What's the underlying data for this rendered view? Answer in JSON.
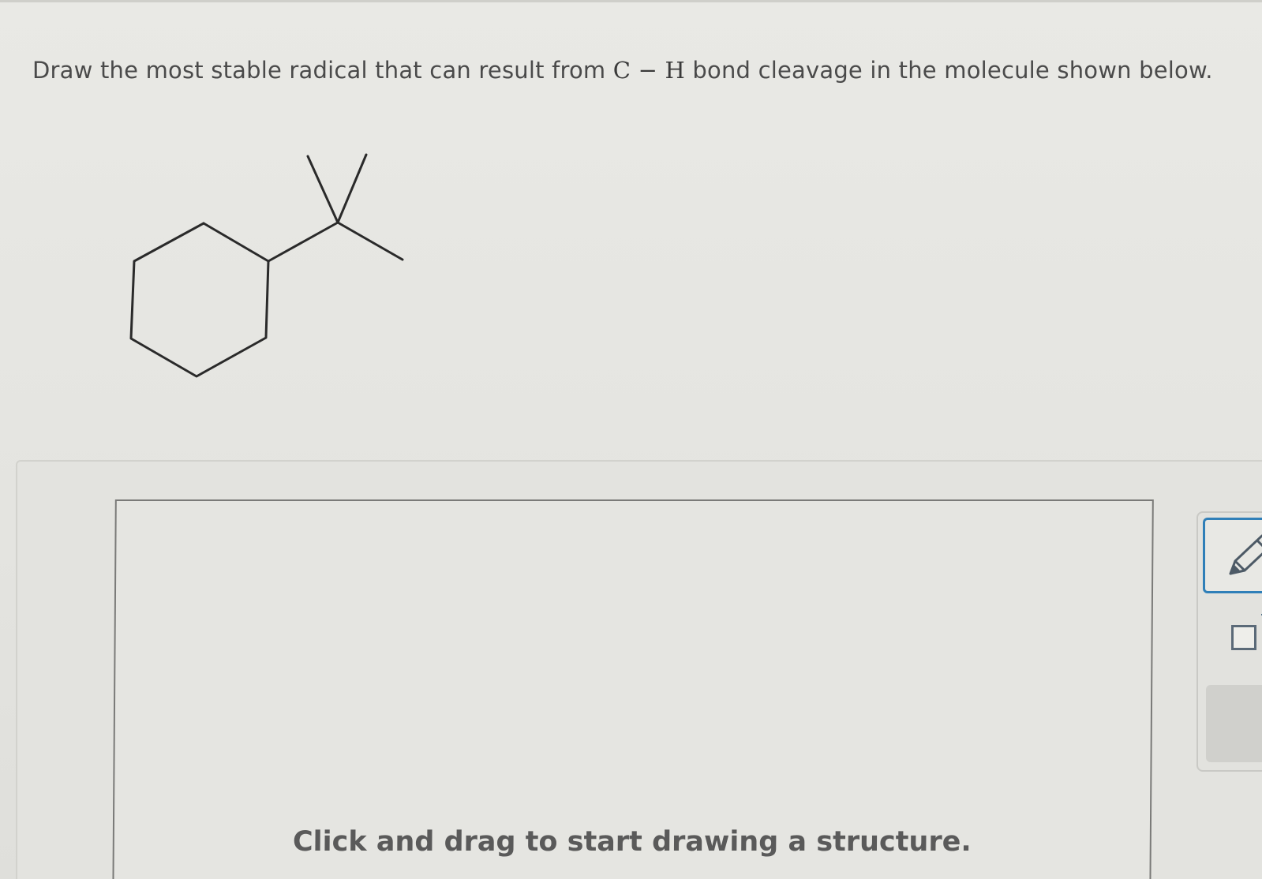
{
  "question": {
    "prefix": "Draw the most stable radical that can result from ",
    "math": "C − H",
    "suffix": " bond cleavage in the molecule shown below."
  },
  "molecule": {
    "description_icon": "tert-butylcyclohexane-skeletal-structure"
  },
  "drawing_canvas": {
    "hint": "Click and drag to start drawing a structure."
  },
  "toolbar": {
    "pencil_icon": "pencil-icon",
    "checkbox_icon": "checkbox-icon",
    "accent_color": "#2f7fb8"
  }
}
